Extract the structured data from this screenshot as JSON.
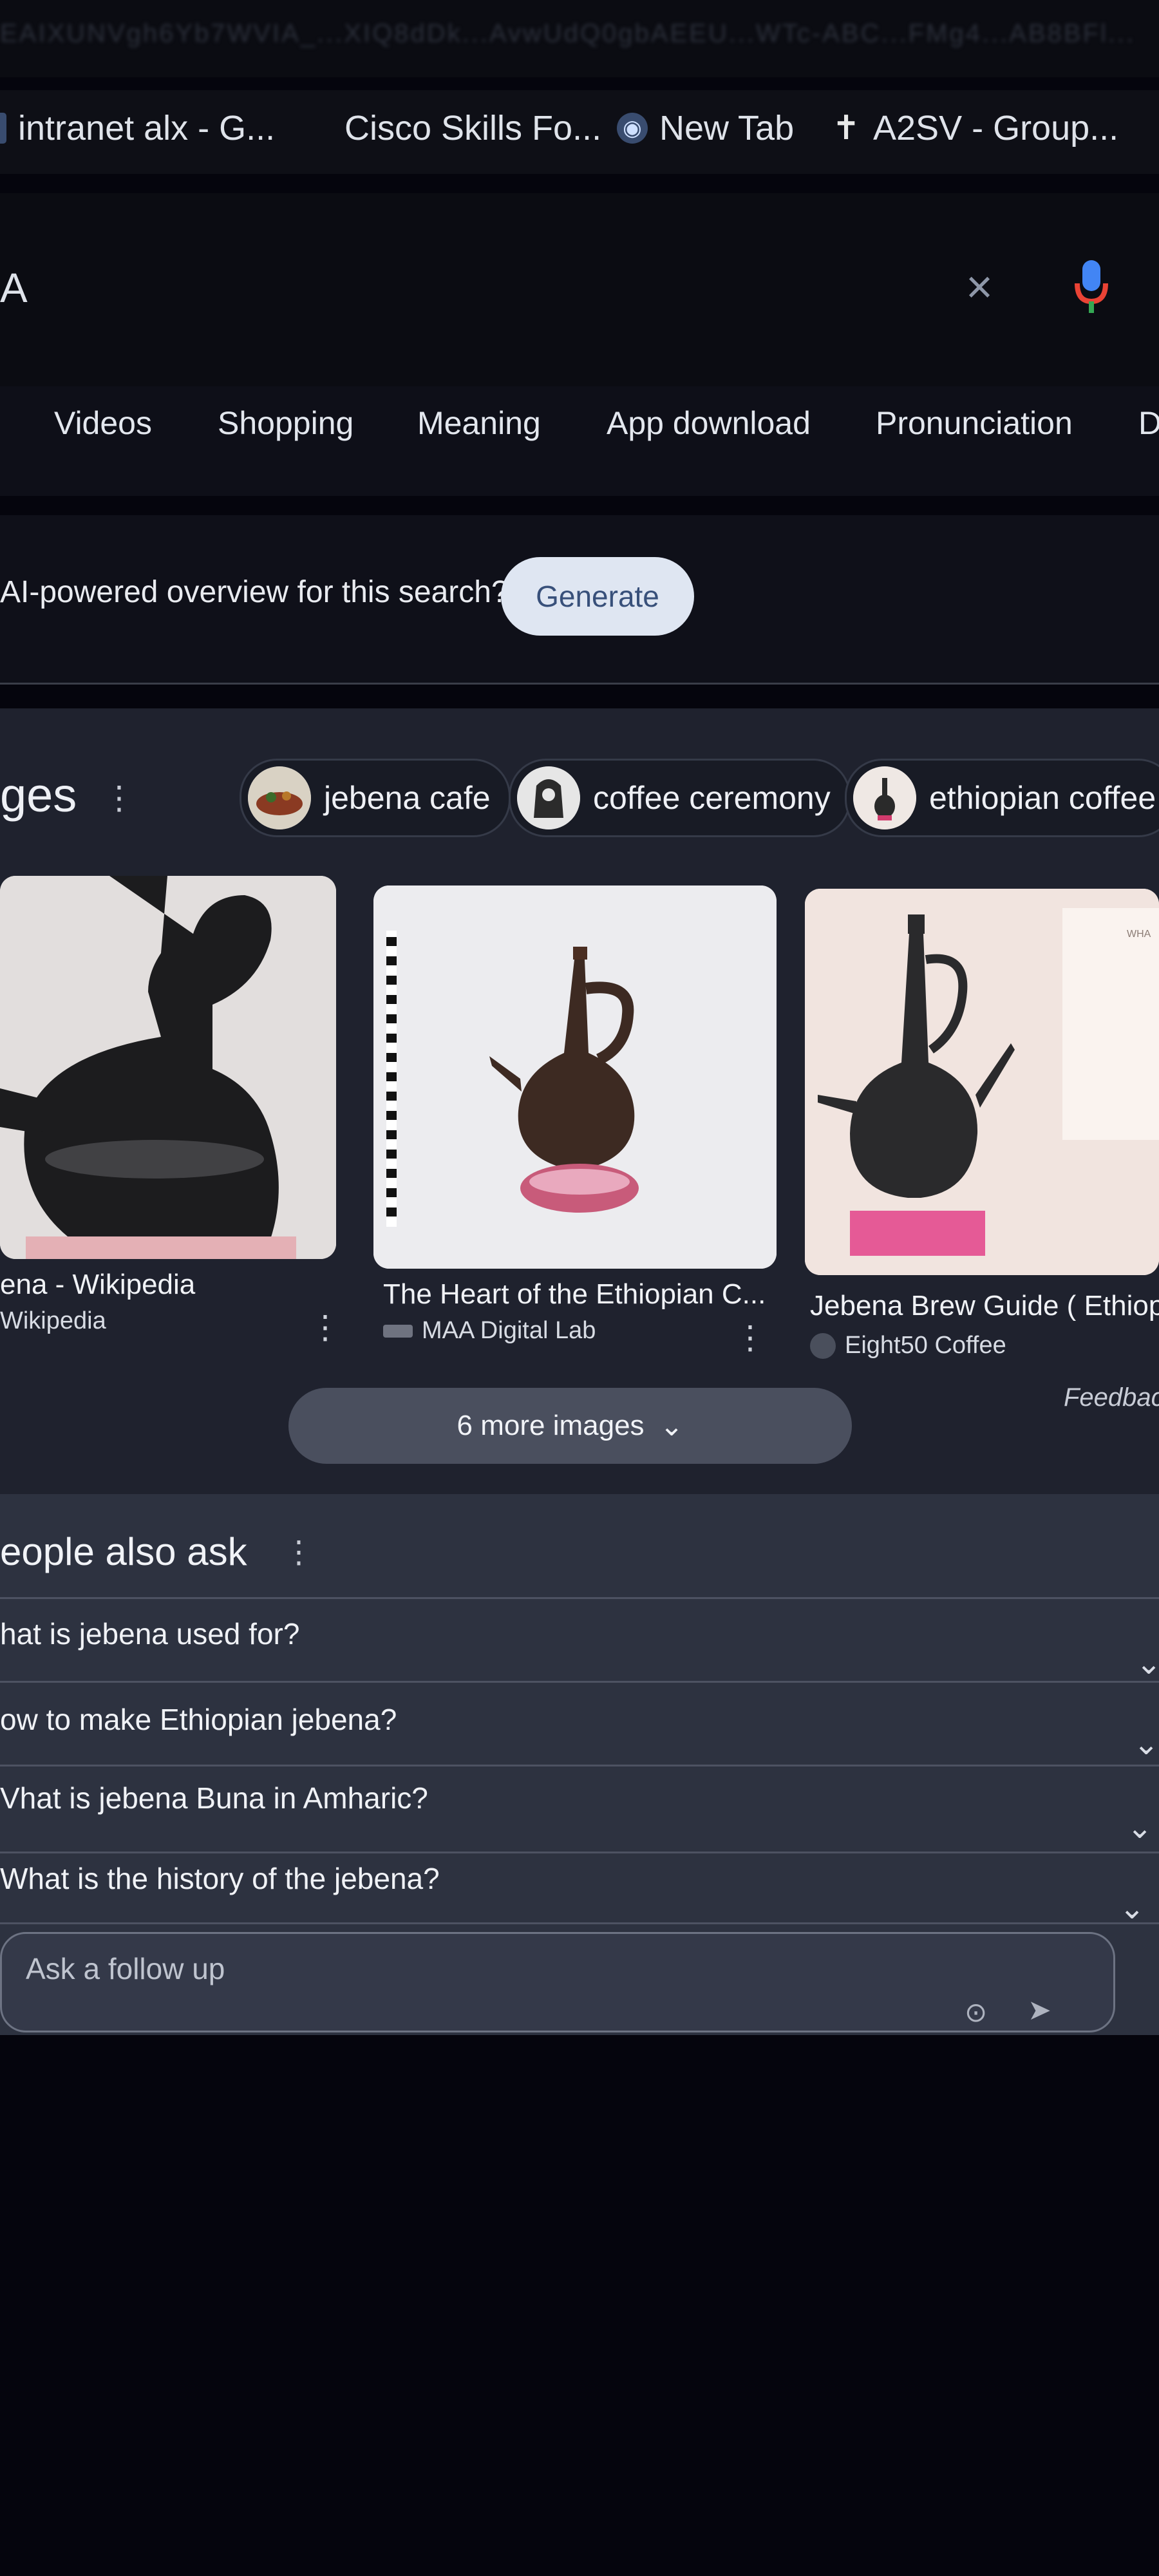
{
  "top": {
    "url_blur": "EAIXUNVgh6Yb7WVIA_...XIQ8dDk...AvwUdQ0gbAEEU...WTc-ABC...FMg4...AB8BFl..."
  },
  "bookmarks": [
    {
      "label": "intranet alx - G...",
      "icon": "alx-icon"
    },
    {
      "label": "Cisco Skills Fo...",
      "icon": "cisco-icon"
    },
    {
      "label": "New Tab",
      "icon": "globe-icon"
    },
    {
      "label": "A2SV - Group...",
      "icon": "cross-icon"
    }
  ],
  "search": {
    "query": "A",
    "clear": "×",
    "mic_icon": "mic-icon"
  },
  "tabs": [
    "Videos",
    "Shopping",
    "Meaning",
    "App download",
    "Pronunciation",
    "D"
  ],
  "ai_overview": {
    "prompt": "AI-powered overview for this search?",
    "button": "Generate"
  },
  "images": {
    "heading": "ges",
    "more_icon": "⋮",
    "chips": [
      "jebena cafe",
      "coffee ceremony",
      "ethiopian coffee"
    ],
    "cards": [
      {
        "title": "ena - Wikipedia",
        "source": "Wikipedia"
      },
      {
        "title": "The Heart of the Ethiopian C...",
        "source": "MAA Digital Lab"
      },
      {
        "title": "Jebena Brew Guide ( Ethiop",
        "source": "Eight50 Coffee"
      }
    ],
    "feedback": "Feedbac",
    "more_button": "6 more images",
    "more_chevron": "⌄"
  },
  "paa": {
    "heading": "eople also ask",
    "kebab": "⋮",
    "questions": [
      "hat is jebena used for?",
      "ow to make Ethiopian jebena?",
      "Vhat is jebena Buna in Amharic?",
      "What is the history of the jebena?"
    ],
    "follow_up": "Ask a follow up"
  },
  "colors": {
    "accent_blue": "#38507a",
    "mic_red": "#ea4335",
    "mic_blue": "#4285f4",
    "background": "#05050d"
  }
}
